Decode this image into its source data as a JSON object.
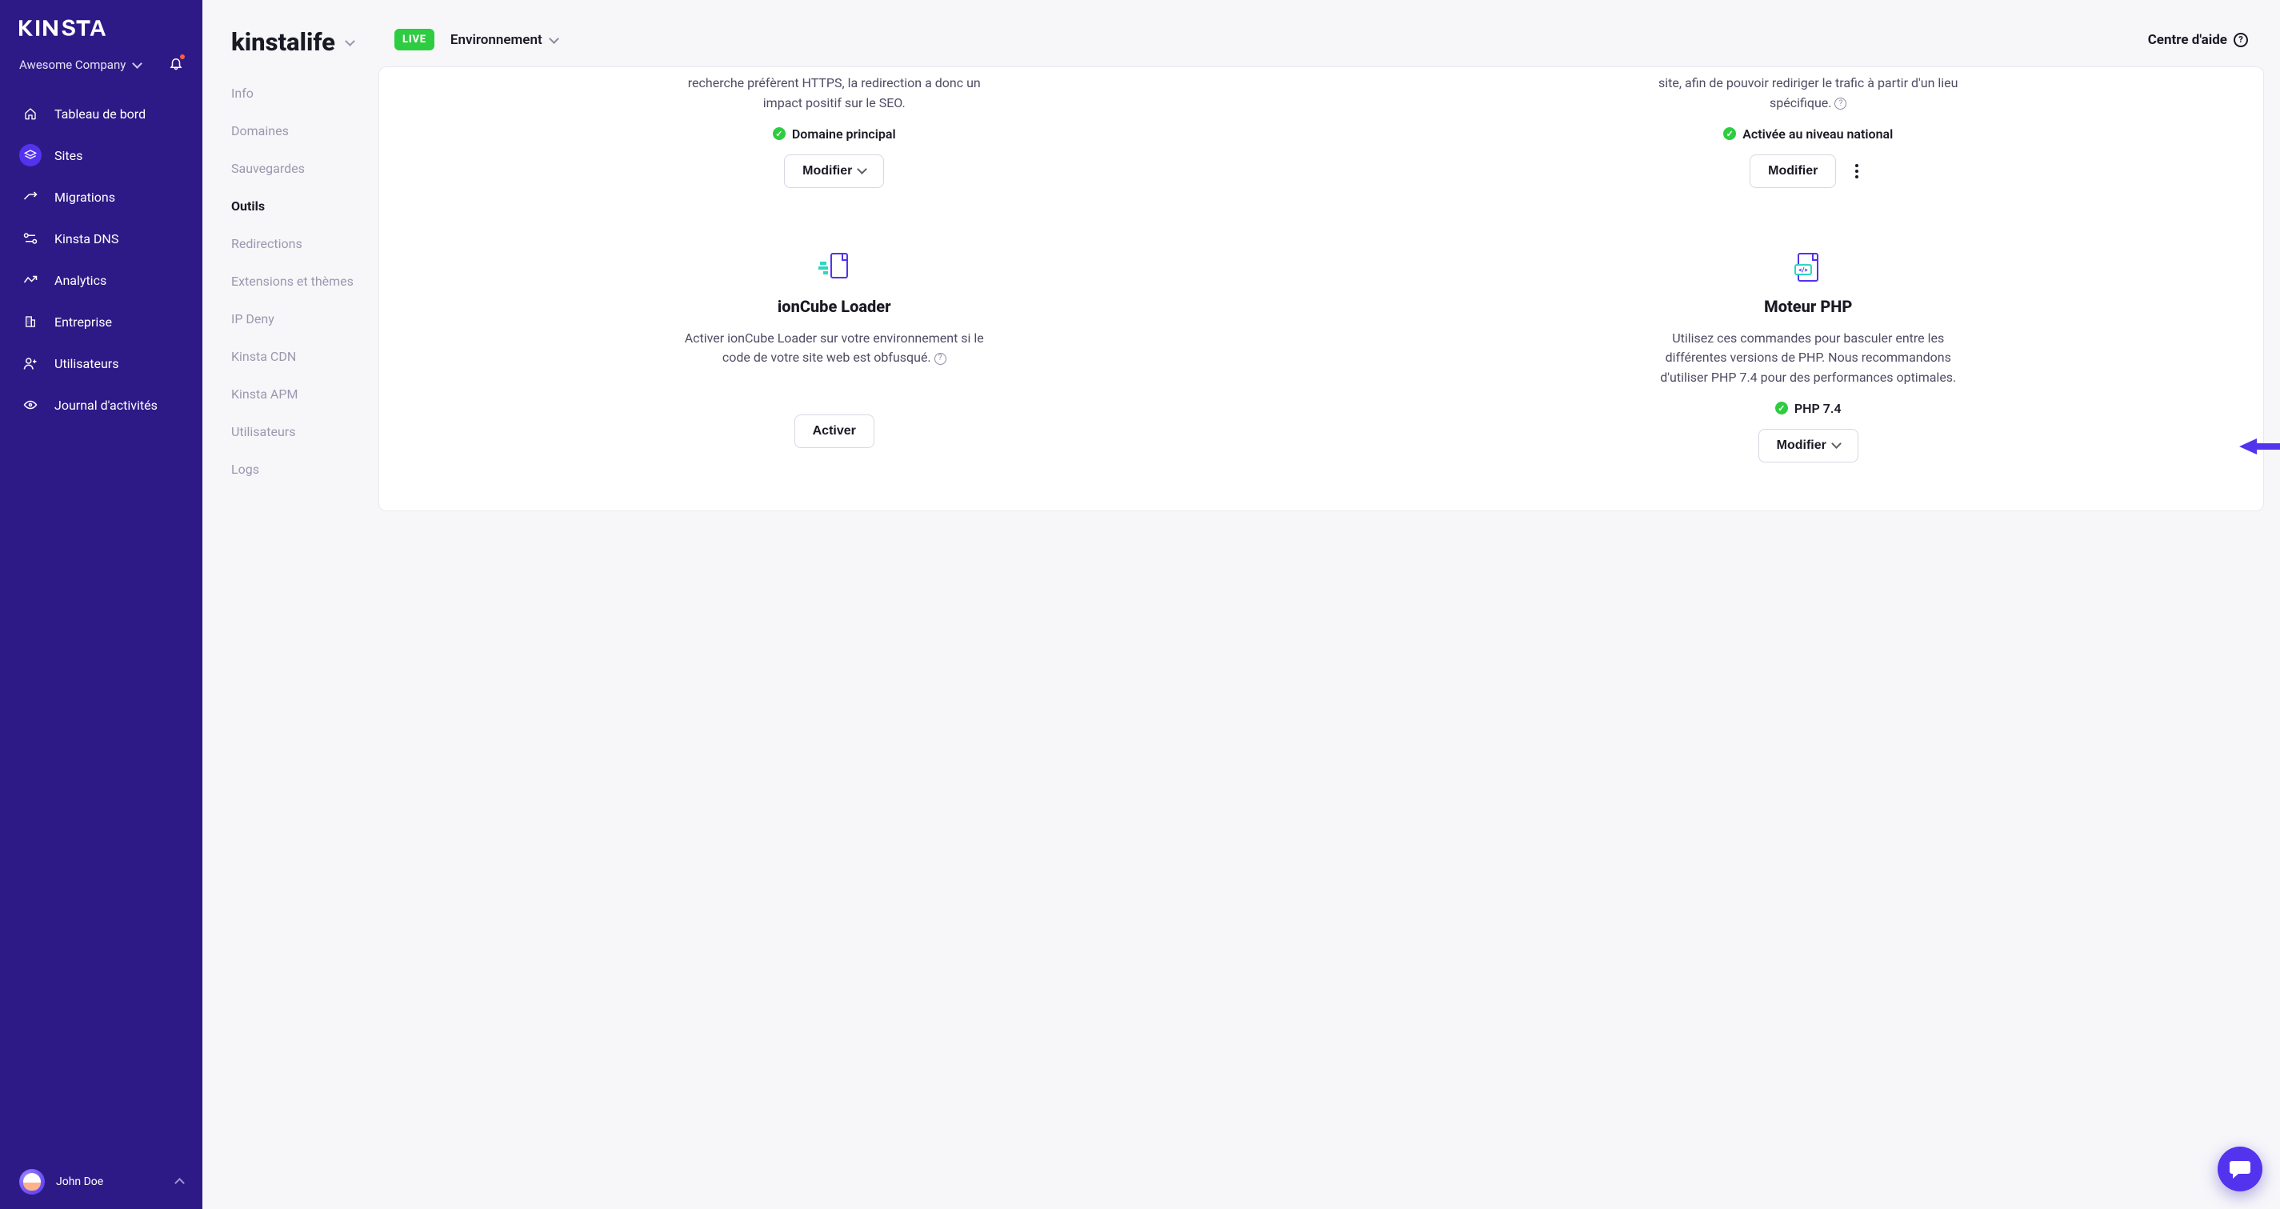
{
  "brand": "Kinsta",
  "company": {
    "name": "Awesome Company"
  },
  "nav": {
    "dashboard": "Tableau de bord",
    "sites": "Sites",
    "migrations": "Migrations",
    "dns": "Kinsta DNS",
    "analytics": "Analytics",
    "company": "Entreprise",
    "users": "Utilisateurs",
    "activity": "Journal d'activités"
  },
  "user": {
    "name": "John Doe"
  },
  "site": {
    "title": "kinstalife"
  },
  "subnav": {
    "info": "Info",
    "domains": "Domaines",
    "backups": "Sauvegardes",
    "tools": "Outils",
    "redirects": "Redirections",
    "plugins": "Extensions et thèmes",
    "ipdeny": "IP Deny",
    "cdn": "Kinsta CDN",
    "apm": "Kinsta APM",
    "users": "Utilisateurs",
    "logs": "Logs"
  },
  "topbar": {
    "live": "LIVE",
    "environment": "Environnement",
    "help": "Centre d'aide"
  },
  "tools": {
    "https": {
      "desc_partial": "recherche préfèrent HTTPS, la redirection a donc un impact positif sur le SEO.",
      "status": "Domaine principal",
      "button": "Modifier"
    },
    "geoip": {
      "desc_partial": "site, afin de pouvoir rediriger le trafic à partir d'un lieu spécifique.",
      "status": "Activée au niveau national",
      "button": "Modifier"
    },
    "ioncube": {
      "title": "ionCube Loader",
      "desc": "Activer ionCube Loader sur votre environnement si le code de votre site web est obfusqué.",
      "button": "Activer"
    },
    "php": {
      "title": "Moteur PHP",
      "desc": "Utilisez ces commandes pour basculer entre les différentes versions de PHP. Nous recommandons d'utiliser PHP 7.4 pour des performances optimales.",
      "status": "PHP 7.4",
      "button": "Modifier"
    }
  }
}
